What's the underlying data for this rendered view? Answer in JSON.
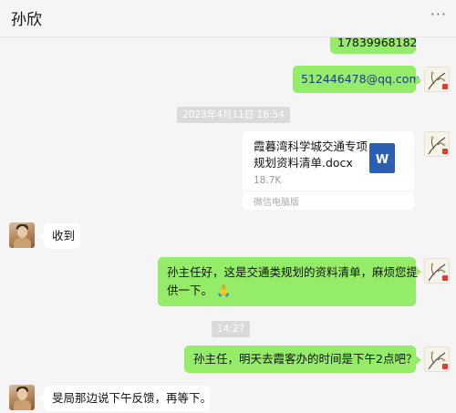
{
  "header": {
    "title": "孙欣",
    "more_icon": "···"
  },
  "messages": {
    "phone": "17839968182",
    "email": "512446478@qq.com",
    "time1": "2023年4月11日 16:54",
    "file": {
      "name": "霞暮湾科学城交通专项规划资料清单.docx",
      "size": "18.7K",
      "source": "微信电脑版",
      "icon_letter": "W"
    },
    "received1": "收到",
    "sent1_line1": "孙主任好，这是交通类规划的资料清单，麻烦您提",
    "sent1_line2": "供一下。",
    "sent1_emoji": "🙏",
    "time2": "14:27",
    "sent2": "孙主任，明天去霞客办的时间是下午2点吧？",
    "received2": "旻局那边说下午反馈，再等下。"
  },
  "colors": {
    "sent_bubble": "#95ec69",
    "received_bubble": "#ffffff",
    "background": "#f5f5f5"
  }
}
